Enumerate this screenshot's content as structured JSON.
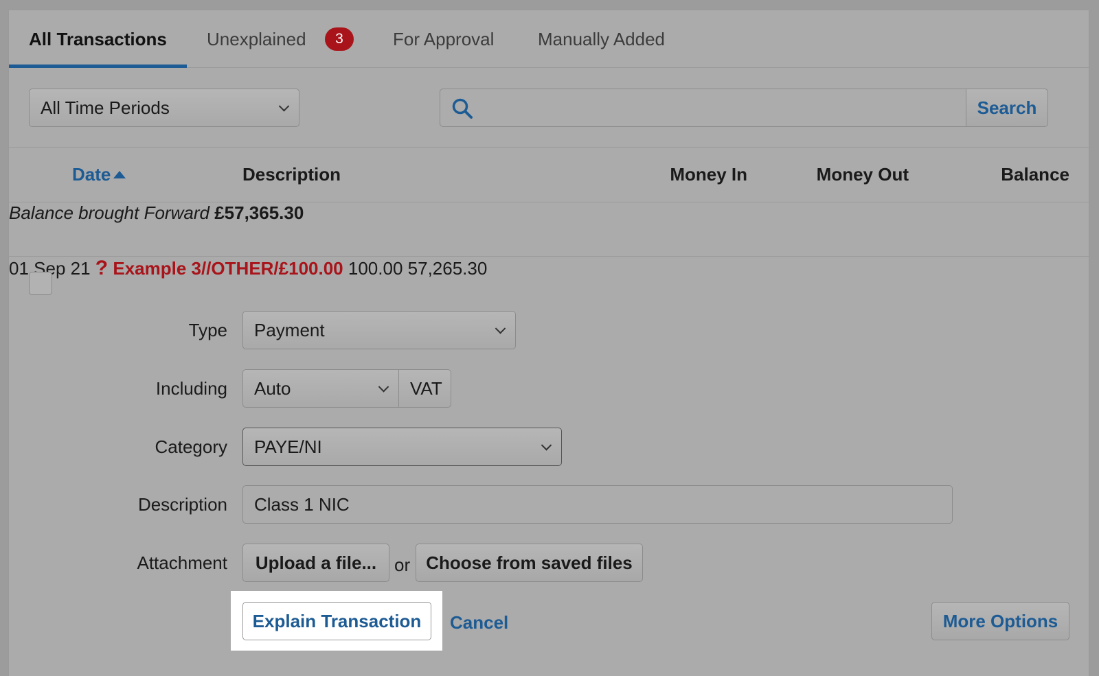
{
  "tabs": [
    {
      "label": "All Transactions",
      "active": true
    },
    {
      "label": "Unexplained",
      "badge": "3"
    },
    {
      "label": "For Approval"
    },
    {
      "label": "Manually Added"
    }
  ],
  "filters": {
    "period": "All Time Periods",
    "search_placeholder": "",
    "search_button": "Search"
  },
  "columns": {
    "date": "Date",
    "description": "Description",
    "money_in": "Money In",
    "money_out": "Money Out",
    "balance": "Balance"
  },
  "brought_forward": {
    "label": "Balance brought Forward",
    "balance": "£57,365.30"
  },
  "transaction": {
    "date": "01 Sep 21",
    "status_icon": "?",
    "description": "Example 3//OTHER/£100.00",
    "money_out": "100.00",
    "balance": "57,265.30"
  },
  "form": {
    "type_label": "Type",
    "type_value": "Payment",
    "including_label": "Including",
    "including_value": "Auto",
    "vat_label": "VAT",
    "category_label": "Category",
    "category_value": "PAYE/NI",
    "description_label": "Description",
    "description_value": "Class 1 NIC",
    "attachment_label": "Attachment",
    "upload_button": "Upload a file...",
    "or_text": "or",
    "saved_files_button": "Choose from saved files",
    "explain_button": "Explain Transaction",
    "cancel_link": "Cancel",
    "more_options_button": "More Options"
  },
  "colors": {
    "accent": "#1d5b94",
    "error": "#a8141a"
  }
}
